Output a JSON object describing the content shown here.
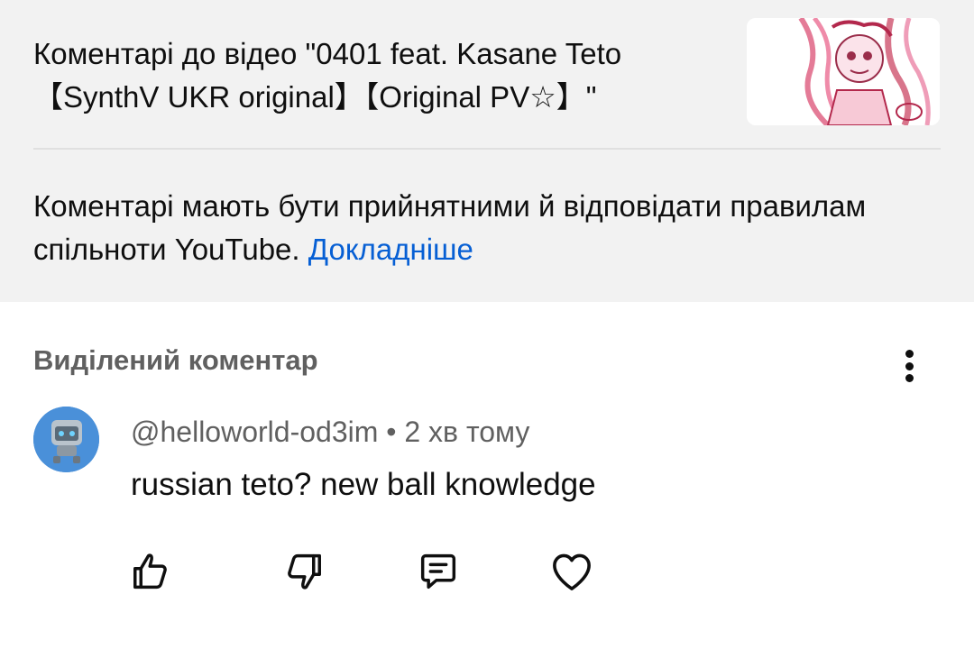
{
  "header": {
    "title": "Коментарі до відео \"0401 feat. Kasane Teto\n【SynthV UKR original】【Original PV☆】\"",
    "thumbnail_icon": "video-thumbnail-anime-art"
  },
  "guidelines": {
    "text": "Коментарі мають бути прийнятними й відповідати правилам спільноти YouTube.",
    "link_label": "Докладніше"
  },
  "highlighted": {
    "heading": "Виділений коментар",
    "more_icon": "more-vertical-icon"
  },
  "comment": {
    "author": "@helloworld-od3im",
    "separator": "•",
    "time": "2 хв тому",
    "text": "russian teto? new ball knowledge",
    "avatar_icon": "robot-avatar"
  },
  "actions": {
    "like_icon": "thumb-up-icon",
    "dislike_icon": "thumb-down-icon",
    "reply_icon": "comment-reply-icon",
    "heart_icon": "heart-icon"
  },
  "colors": {
    "panel_bg": "#f2f2f2",
    "link": "#065fd4",
    "secondary_text": "#606060"
  }
}
